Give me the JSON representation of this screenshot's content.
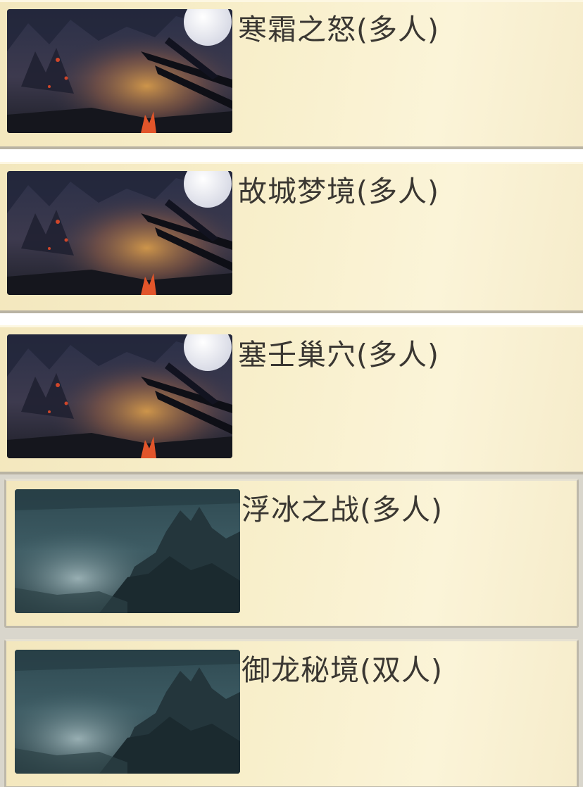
{
  "maps": [
    {
      "title": "寒霜之怒(多人)",
      "thumbnail": "moonlit-battlefield-thumbnail"
    },
    {
      "title": "故城梦境(多人)",
      "thumbnail": "moonlit-battlefield-thumbnail"
    },
    {
      "title": "塞壬巢穴(多人)",
      "thumbnail": "moonlit-battlefield-thumbnail"
    },
    {
      "title": "浮冰之战(多人)",
      "thumbnail": "misty-mountain-thumbnail"
    },
    {
      "title": "御龙秘境(双人)",
      "thumbnail": "misty-mountain-thumbnail"
    }
  ],
  "colors": {
    "card_background": "#f8efcb",
    "title_text": "#3a3732",
    "card_border": "#b9b3a3"
  }
}
